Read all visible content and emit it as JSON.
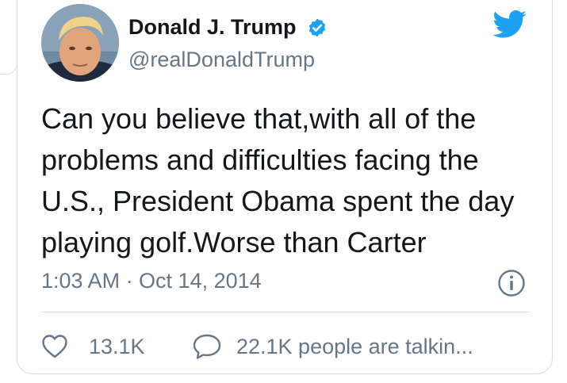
{
  "tweet": {
    "author": {
      "name": "Donald J. Trump",
      "handle": "@realDonaldTrump",
      "verified": true,
      "avatar_icon": "profile-photo"
    },
    "text_lines": [
      "Can you believe that,with all of the",
      "problems and difficulties facing the",
      "U.S., President Obama spent the day",
      "playing golf.Worse than Carter"
    ],
    "timestamp": "1:03 AM · Oct 14, 2014",
    "actions": {
      "like_count": "13.1K",
      "reply_text": "22.1K people are talkin..."
    }
  },
  "icons": {
    "brand": "twitter-bird-icon",
    "verified": "verified-badge-icon",
    "info": "info-icon",
    "like": "heart-icon",
    "reply": "speech-bubble-icon"
  },
  "colors": {
    "brand_blue": "#1da1f2",
    "text_primary": "#14171a",
    "text_secondary": "#657786",
    "divider": "#cfd9de"
  }
}
